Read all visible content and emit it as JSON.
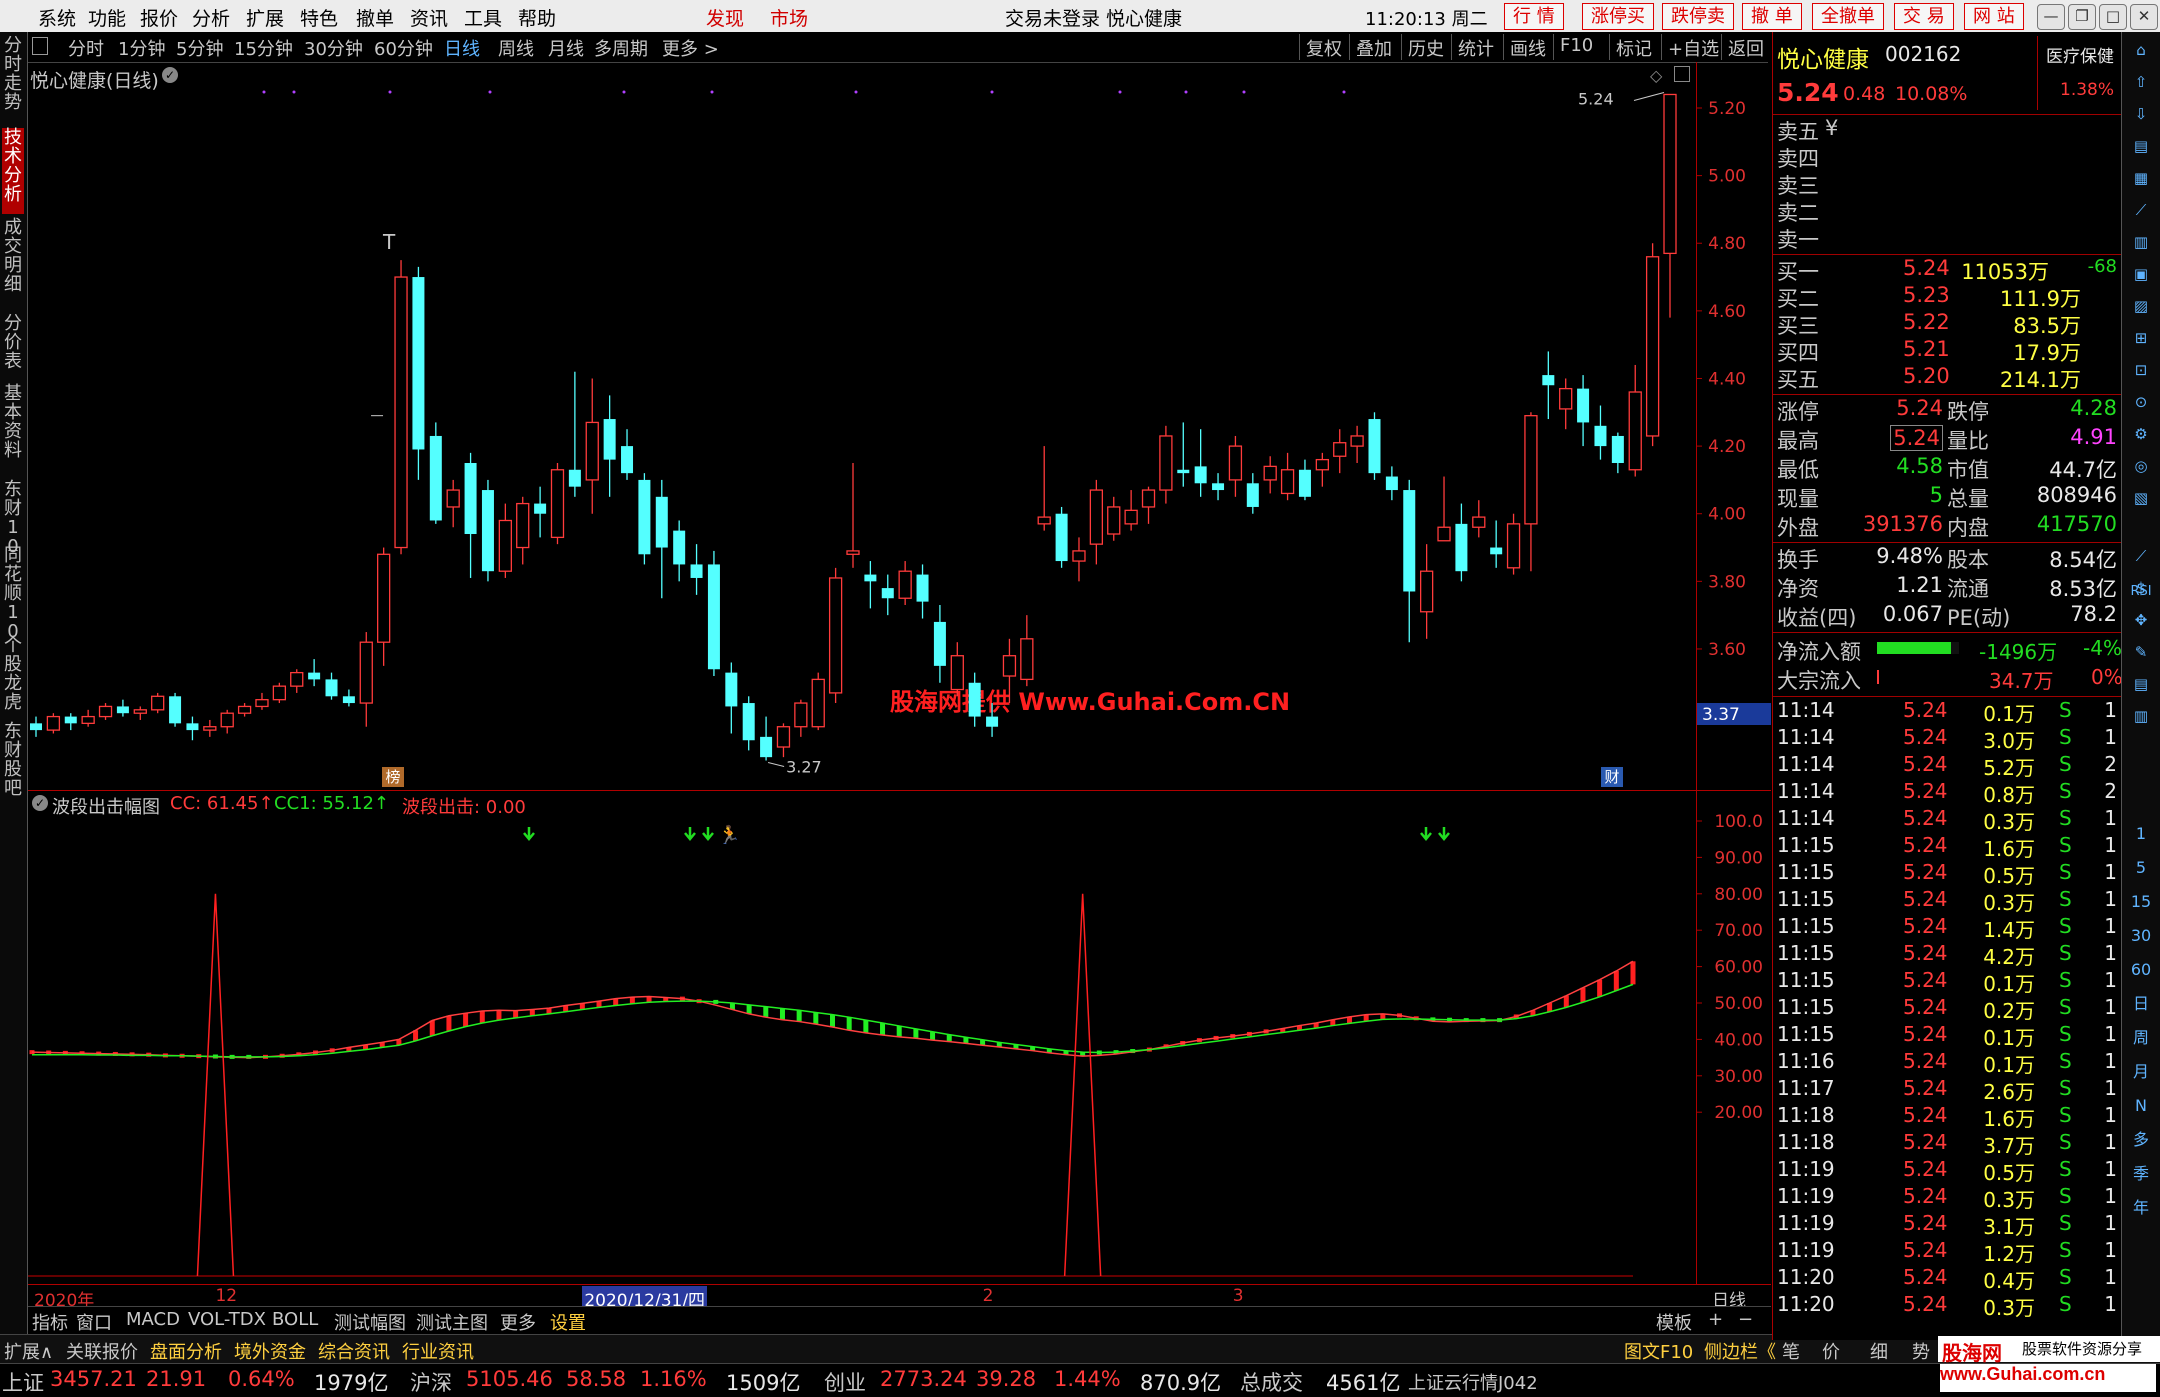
{
  "menu": {
    "items": [
      "系统",
      "功能",
      "报价",
      "分析",
      "扩展",
      "特色",
      "撤单",
      "资讯",
      "工具",
      "帮助"
    ],
    "highlight": [
      "发现",
      "市场"
    ],
    "title": "交易未登录  悦心健康",
    "time": "11:20:13 周二",
    "right_buttons": [
      "行 情",
      "涨停买",
      "跌停卖",
      "撤 单",
      "全撤单",
      "交 易",
      "网 站"
    ]
  },
  "periods": [
    "分时",
    "1分钟",
    "5分钟",
    "15分钟",
    "30分钟",
    "60分钟",
    "日线",
    "周线",
    "月线",
    "多周期",
    "更多 >"
  ],
  "active_period": "日线",
  "tools": [
    "复权",
    "叠加",
    "历史",
    "统计",
    "画线",
    "F10",
    "标记",
    "+自选",
    "返回"
  ],
  "left_tabs": [
    "分时走势",
    "技术分析",
    "成交明细",
    "分价表",
    "基本资料",
    "东财10",
    "同花顺10",
    "个股龙虎",
    "东财股吧"
  ],
  "active_left_tab": "技术分析",
  "main_chart": {
    "title": "悦心健康(日线)",
    "y_ticks": [
      "5.20",
      "5.00",
      "4.80",
      "4.60",
      "4.40",
      "4.20",
      "4.00",
      "3.80",
      "3.60"
    ],
    "price_label": "3.37",
    "high_marker": "5.24",
    "low_marker": "3.27",
    "watermark": "股海网提供 Www.Guhai.Com.CN",
    "bang_label": "榜",
    "cai_label": "财",
    "candles": [
      [
        3.38,
        3.36,
        3.4,
        3.34
      ],
      [
        3.36,
        3.4,
        3.41,
        3.35
      ],
      [
        3.4,
        3.38,
        3.41,
        3.36
      ],
      [
        3.38,
        3.4,
        3.42,
        3.37
      ],
      [
        3.4,
        3.43,
        3.44,
        3.39
      ],
      [
        3.43,
        3.41,
        3.45,
        3.4
      ],
      [
        3.41,
        3.42,
        3.43,
        3.39
      ],
      [
        3.42,
        3.46,
        3.47,
        3.41
      ],
      [
        3.46,
        3.38,
        3.47,
        3.37
      ],
      [
        3.38,
        3.36,
        3.4,
        3.33
      ],
      [
        3.36,
        3.37,
        3.39,
        3.34
      ],
      [
        3.37,
        3.41,
        3.42,
        3.35
      ],
      [
        3.41,
        3.43,
        3.44,
        3.4
      ],
      [
        3.43,
        3.45,
        3.47,
        3.42
      ],
      [
        3.45,
        3.49,
        3.5,
        3.44
      ],
      [
        3.49,
        3.53,
        3.54,
        3.47
      ],
      [
        3.53,
        3.51,
        3.57,
        3.49
      ],
      [
        3.51,
        3.46,
        3.53,
        3.45
      ],
      [
        3.46,
        3.44,
        3.48,
        3.43
      ],
      [
        3.44,
        3.62,
        3.65,
        3.37
      ],
      [
        3.62,
        3.88,
        3.9,
        3.55
      ],
      [
        3.9,
        4.7,
        4.75,
        3.88
      ],
      [
        4.7,
        4.19,
        4.73,
        4.1
      ],
      [
        4.23,
        3.98,
        4.27,
        3.97
      ],
      [
        4.02,
        4.07,
        4.1,
        3.96
      ],
      [
        4.15,
        3.94,
        4.18,
        3.81
      ],
      [
        4.07,
        3.83,
        4.1,
        3.8
      ],
      [
        3.83,
        3.98,
        4.03,
        3.81
      ],
      [
        3.9,
        4.03,
        4.05,
        3.85
      ],
      [
        4.03,
        4.0,
        4.08,
        3.93
      ],
      [
        3.93,
        4.13,
        4.15,
        3.91
      ],
      [
        4.13,
        4.08,
        4.42,
        4.05
      ],
      [
        4.1,
        4.27,
        4.4,
        4.0
      ],
      [
        4.28,
        4.16,
        4.35,
        4.05
      ],
      [
        4.2,
        4.12,
        4.25,
        4.1
      ],
      [
        4.1,
        3.88,
        4.12,
        3.85
      ],
      [
        4.05,
        3.9,
        4.1,
        3.75
      ],
      [
        3.95,
        3.85,
        3.98,
        3.8
      ],
      [
        3.85,
        3.81,
        3.91,
        3.76
      ],
      [
        3.85,
        3.54,
        3.89,
        3.52
      ],
      [
        3.53,
        3.43,
        3.56,
        3.35
      ],
      [
        3.44,
        3.33,
        3.46,
        3.3
      ],
      [
        3.34,
        3.28,
        3.4,
        3.27
      ],
      [
        3.31,
        3.37,
        3.38,
        3.28
      ],
      [
        3.37,
        3.44,
        3.45,
        3.34
      ],
      [
        3.37,
        3.51,
        3.53,
        3.36
      ],
      [
        3.47,
        3.81,
        3.84,
        3.44
      ],
      [
        3.88,
        3.89,
        4.15,
        3.84
      ],
      [
        3.82,
        3.8,
        3.86,
        3.72
      ],
      [
        3.78,
        3.75,
        3.82,
        3.7
      ],
      [
        3.75,
        3.83,
        3.86,
        3.73
      ],
      [
        3.82,
        3.74,
        3.85,
        3.69
      ],
      [
        3.68,
        3.55,
        3.73,
        3.5
      ],
      [
        3.48,
        3.58,
        3.62,
        3.46
      ],
      [
        3.5,
        3.4,
        3.53,
        3.37
      ],
      [
        3.4,
        3.37,
        3.44,
        3.34
      ],
      [
        3.52,
        3.58,
        3.63,
        3.44
      ],
      [
        3.51,
        3.63,
        3.7,
        3.49
      ],
      [
        3.97,
        3.99,
        4.2,
        3.95
      ],
      [
        4.0,
        3.86,
        4.02,
        3.84
      ],
      [
        3.86,
        3.89,
        3.93,
        3.8
      ],
      [
        3.91,
        4.07,
        4.1,
        3.85
      ],
      [
        3.94,
        4.02,
        4.05,
        3.92
      ],
      [
        3.97,
        4.01,
        4.07,
        3.95
      ],
      [
        4.02,
        4.07,
        4.08,
        3.97
      ],
      [
        4.07,
        4.23,
        4.26,
        4.03
      ],
      [
        4.13,
        4.12,
        4.27,
        4.08
      ],
      [
        4.14,
        4.09,
        4.25,
        4.05
      ],
      [
        4.09,
        4.07,
        4.12,
        4.04
      ],
      [
        4.1,
        4.2,
        4.23,
        4.05
      ],
      [
        4.09,
        4.02,
        4.12,
        4.0
      ],
      [
        4.1,
        4.14,
        4.17,
        4.06
      ],
      [
        4.06,
        4.13,
        4.18,
        4.04
      ],
      [
        4.13,
        4.05,
        4.16,
        4.04
      ],
      [
        4.13,
        4.16,
        4.18,
        4.08
      ],
      [
        4.17,
        4.21,
        4.25,
        4.12
      ],
      [
        4.2,
        4.23,
        4.26,
        4.15
      ],
      [
        4.28,
        4.12,
        4.3,
        4.1
      ],
      [
        4.11,
        4.07,
        4.14,
        4.04
      ],
      [
        4.07,
        3.77,
        4.1,
        3.62
      ],
      [
        3.71,
        3.83,
        3.91,
        3.63
      ],
      [
        3.92,
        3.96,
        4.11,
        3.94
      ],
      [
        3.97,
        3.83,
        4.03,
        3.8
      ],
      [
        3.96,
        3.99,
        4.04,
        3.93
      ],
      [
        3.9,
        3.88,
        3.98,
        3.84
      ],
      [
        3.84,
        3.97,
        4.0,
        3.82
      ],
      [
        3.97,
        4.29,
        4.3,
        3.83
      ],
      [
        4.41,
        4.38,
        4.48,
        4.28
      ],
      [
        4.31,
        4.37,
        4.4,
        4.25
      ],
      [
        4.37,
        4.27,
        4.41,
        4.2
      ],
      [
        4.26,
        4.2,
        4.32,
        4.16
      ],
      [
        4.23,
        4.15,
        4.24,
        4.12
      ],
      [
        4.13,
        4.36,
        4.44,
        4.11
      ],
      [
        4.23,
        4.76,
        4.8,
        4.2
      ],
      [
        4.77,
        5.24,
        5.24,
        4.58
      ]
    ]
  },
  "indicator": {
    "name": "波段出击幅图",
    "cc_label": "CC: 61.45↑",
    "cc1_label": "CC1: 55.12↑",
    "wave_label": "波段出击: 0.00",
    "y_ticks": [
      "100.0",
      "90.00",
      "80.00",
      "70.00",
      "60.00",
      "50.00",
      "40.00",
      "30.00",
      "20.00"
    ],
    "cc": [
      36.5,
      36.4,
      36.3,
      36.2,
      36.1,
      36.0,
      35.9,
      35.8,
      35.6,
      35.5,
      35.4,
      35.2,
      35.1,
      35.0,
      35.2,
      35.5,
      35.9,
      36.4,
      37.0,
      37.8,
      38.5,
      39.2,
      40.0,
      42.5,
      45.2,
      46.5,
      47.2,
      47.8,
      48.0,
      47.9,
      48.2,
      48.6,
      49.3,
      49.9,
      50.5,
      51.2,
      51.6,
      51.8,
      51.5,
      51.2,
      50.5,
      49.4,
      48.2,
      47.0,
      46.1,
      45.4,
      44.9,
      44.2,
      43.4,
      42.5,
      41.8,
      41.2,
      40.7,
      40.3,
      39.8,
      39.4,
      38.9,
      38.4,
      37.9,
      37.4,
      36.9,
      36.3,
      35.8,
      35.4,
      35.6,
      36.0,
      36.6,
      37.2,
      38.1,
      39.0,
      39.8,
      40.4,
      40.9,
      41.5,
      42.2,
      43.0,
      43.8,
      44.5,
      45.4,
      46.2,
      46.8,
      47.0,
      46.6,
      45.8,
      45.0,
      44.8,
      45.0,
      45.1,
      45.2,
      46.3,
      48.0,
      50.0,
      52.0,
      54.2,
      56.4,
      58.8,
      61.45
    ],
    "cc1": [
      35.8,
      35.8,
      35.8,
      35.8,
      35.7,
      35.7,
      35.6,
      35.6,
      35.5,
      35.5,
      35.4,
      35.3,
      35.2,
      35.2,
      35.2,
      35.3,
      35.5,
      35.8,
      36.2,
      36.7,
      37.2,
      37.8,
      38.4,
      39.6,
      41.0,
      42.3,
      43.5,
      44.5,
      45.3,
      45.9,
      46.5,
      47.0,
      47.6,
      48.2,
      48.8,
      49.3,
      49.8,
      50.2,
      50.4,
      50.5,
      50.5,
      50.3,
      50.0,
      49.5,
      49.0,
      48.5,
      48.0,
      47.4,
      46.8,
      46.1,
      45.3,
      44.5,
      43.7,
      42.9,
      42.1,
      41.3,
      40.6,
      39.9,
      39.2,
      38.6,
      38.0,
      37.4,
      36.9,
      36.5,
      36.4,
      36.5,
      36.8,
      37.2,
      37.7,
      38.3,
      38.9,
      39.5,
      40.1,
      40.7,
      41.3,
      41.9,
      42.5,
      43.1,
      43.8,
      44.4,
      45.0,
      45.5,
      45.6,
      45.6,
      45.5,
      45.4,
      45.3,
      45.3,
      45.3,
      45.7,
      46.5,
      47.6,
      48.8,
      50.2,
      51.7,
      53.4,
      55.12
    ],
    "spike_positions": [
      11,
      63
    ],
    "spike_value": 80
  },
  "x_axis": {
    "labels": [
      {
        "text": "2020年",
        "at": 0
      },
      {
        "text": "12",
        "at": 11
      },
      {
        "text": "2020/12/31/四",
        "at": 33
      },
      {
        "text": "2",
        "at": 57
      },
      {
        "text": "3",
        "at": 72
      }
    ],
    "period": "日线"
  },
  "bottom_tabs": [
    "指标",
    "窗口",
    "MACD",
    "VOL-TDX",
    "BOLL",
    "测试幅图",
    "测试主图",
    "更多",
    "设置"
  ],
  "bottom_tabs_right": [
    "模板",
    "+",
    "−"
  ],
  "strip2": [
    "扩展∧",
    "关联报价",
    "盘面分析",
    "境外资金",
    "综合资讯",
    "行业资讯"
  ],
  "strip2_right": [
    "图文F10",
    "侧边栏《",
    "笔",
    "价",
    "细",
    "势"
  ],
  "stock": {
    "name": "悦心健康",
    "code": "002162",
    "sector": "医疗保健",
    "sector_pct": "1.38%",
    "price": "5.24",
    "change": "0.48",
    "pct": "10.08%",
    "sell": [
      "卖五",
      "卖四",
      "卖三",
      "卖二",
      "卖一"
    ],
    "sell_tag": "¥",
    "buy": [
      {
        "label": "买一",
        "price": "5.24",
        "vol": "11053万",
        "delta": "-68"
      },
      {
        "label": "买二",
        "price": "5.23",
        "vol": "111.9万"
      },
      {
        "label": "买三",
        "price": "5.22",
        "vol": "83.5万"
      },
      {
        "label": "买四",
        "price": "5.21",
        "vol": "17.9万"
      },
      {
        "label": "买五",
        "price": "5.20",
        "vol": "214.1万"
      }
    ],
    "stats": [
      {
        "l1": "涨停",
        "v1": "5.24",
        "l2": "跌停",
        "v2": "4.28",
        "c1": "red",
        "c2": "green"
      },
      {
        "l1": "最高",
        "v1": "5.24",
        "l2": "量比",
        "v2": "4.91",
        "c1": "red",
        "c2": "magenta"
      },
      {
        "l1": "最低",
        "v1": "4.58",
        "l2": "市值",
        "v2": "44.7亿",
        "c1": "green",
        "c2": "white"
      },
      {
        "l1": "现量",
        "v1": "5",
        "l2": "总量",
        "v2": "808946",
        "c1": "green",
        "c2": "white"
      },
      {
        "l1": "外盘",
        "v1": "391376",
        "l2": "内盘",
        "v2": "417570",
        "c1": "red",
        "c2": "green"
      }
    ],
    "stats2": [
      {
        "l1": "换手",
        "v1": "9.48%",
        "l2": "股本",
        "v2": "8.54亿"
      },
      {
        "l1": "净资",
        "v1": "1.21",
        "l2": "流通",
        "v2": "8.53亿"
      },
      {
        "l1": "收益(四)",
        "v1": "0.067",
        "l2": "PE(动)",
        "v2": "78.2"
      }
    ],
    "netflow": {
      "label": "净流入额",
      "value": "-1496万",
      "pct": "-4%",
      "bar_fraction": 0.9
    },
    "block": {
      "label": "大宗流入",
      "value": "34.7万",
      "pct": "0%"
    }
  },
  "ticks": [
    [
      "11:14",
      "5.24",
      "0.1万",
      "S",
      "1"
    ],
    [
      "11:14",
      "5.24",
      "3.0万",
      "S",
      "1"
    ],
    [
      "11:14",
      "5.24",
      "5.2万",
      "S",
      "2"
    ],
    [
      "11:14",
      "5.24",
      "0.8万",
      "S",
      "2"
    ],
    [
      "11:14",
      "5.24",
      "0.3万",
      "S",
      "1"
    ],
    [
      "11:15",
      "5.24",
      "1.6万",
      "S",
      "1"
    ],
    [
      "11:15",
      "5.24",
      "0.5万",
      "S",
      "1"
    ],
    [
      "11:15",
      "5.24",
      "0.3万",
      "S",
      "1"
    ],
    [
      "11:15",
      "5.24",
      "1.4万",
      "S",
      "1"
    ],
    [
      "11:15",
      "5.24",
      "4.2万",
      "S",
      "1"
    ],
    [
      "11:15",
      "5.24",
      "0.1万",
      "S",
      "1"
    ],
    [
      "11:15",
      "5.24",
      "0.2万",
      "S",
      "1"
    ],
    [
      "11:15",
      "5.24",
      "0.1万",
      "S",
      "1"
    ],
    [
      "11:16",
      "5.24",
      "0.1万",
      "S",
      "1"
    ],
    [
      "11:17",
      "5.24",
      "2.6万",
      "S",
      "1"
    ],
    [
      "11:18",
      "5.24",
      "1.6万",
      "S",
      "1"
    ],
    [
      "11:18",
      "5.24",
      "3.7万",
      "S",
      "1"
    ],
    [
      "11:19",
      "5.24",
      "0.5万",
      "S",
      "1"
    ],
    [
      "11:19",
      "5.24",
      "0.3万",
      "S",
      "1"
    ],
    [
      "11:19",
      "5.24",
      "3.1万",
      "S",
      "1"
    ],
    [
      "11:19",
      "5.24",
      "1.2万",
      "S",
      "1"
    ],
    [
      "11:20",
      "5.24",
      "0.4万",
      "S",
      "1"
    ],
    [
      "11:20",
      "5.24",
      "0.3万",
      "S",
      "1"
    ]
  ],
  "right_icon_labels": [
    "RSI",
    "1",
    "5",
    "15",
    "30",
    "60",
    "日",
    "周",
    "月",
    "N",
    "多",
    "季",
    "年"
  ],
  "status": {
    "sh": {
      "name": "上证",
      "value": "3457.21",
      "chg": "21.91",
      "pct": "0.64%",
      "amt": "1979亿"
    },
    "hs": {
      "name": "沪深",
      "value": "5105.46",
      "chg": "58.58",
      "pct": "1.16%",
      "amt": "1509亿"
    },
    "cy": {
      "name": "创业",
      "value": "2773.24",
      "chg": "39.28",
      "pct": "1.44%",
      "amt": "870.9亿"
    },
    "total_label": "总成交",
    "total": "4561亿",
    "cloud": "上证云行情J042",
    "brand": "股海网",
    "brand_sub": "股票软件资源分享",
    "brand_url": "www.Guhai.com.cn"
  }
}
